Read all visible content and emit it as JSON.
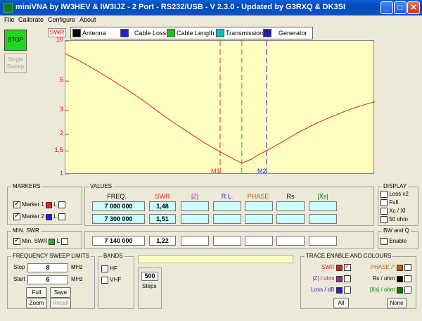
{
  "window": {
    "title": "miniVNA by IW3HEV & IW3IJZ - 2 Port - RS232/USB - V 2.3.0 - Updated by G3RXQ & DK3SI",
    "buttons": {
      "minimize": "_",
      "maximize": "□",
      "close": "✕"
    }
  },
  "menu": {
    "file": "File",
    "calibrate": "Calibrate",
    "configure": "Configure",
    "about": "About"
  },
  "left_controls": {
    "stop": "STOP",
    "single_sweep": "Single Sweep"
  },
  "trace_toolbar": {
    "swr_tag": "SWR",
    "tabs": [
      {
        "label": "Antenna",
        "icon": "antenna-icon",
        "color": "#000000"
      },
      {
        "label": "Cable Loss",
        "icon": "cable-loss-icon",
        "color": "#2020e0"
      },
      {
        "label": "Cable Length",
        "icon": "cable-length-icon",
        "color": "#20c020"
      },
      {
        "label": "Transmission",
        "icon": "transmission-icon",
        "color": "#00c0c0"
      },
      {
        "label": "Generator",
        "icon": "generator-icon",
        "color": "#2020a0"
      }
    ]
  },
  "chart_data": {
    "type": "line",
    "y_scale": "log",
    "ylim": [
      1,
      10
    ],
    "ylabel": "SWR",
    "yticks": [
      "10",
      "5",
      "3",
      "2",
      "1,5",
      "1"
    ],
    "xlim": [
      6.0,
      8.0
    ],
    "x_unit": "MHz",
    "grid": false,
    "background": "#ffffc0",
    "series": [
      {
        "color": "#e02020",
        "x": [
          6.0,
          6.1,
          6.2,
          6.3,
          6.4,
          6.5,
          6.6,
          6.7,
          6.8,
          6.9,
          7.0,
          7.05,
          7.1,
          7.14,
          7.2,
          7.25,
          7.3,
          7.4,
          7.5,
          7.6,
          7.7,
          7.8,
          7.9,
          8.0
        ],
        "y": [
          8.0,
          7.0,
          6.0,
          5.1,
          4.3,
          3.6,
          2.95,
          2.45,
          2.05,
          1.72,
          1.48,
          1.38,
          1.28,
          1.22,
          1.3,
          1.41,
          1.51,
          1.75,
          2.05,
          2.35,
          2.65,
          2.95,
          3.25,
          3.5
        ]
      }
    ],
    "markers": [
      {
        "label": "M1",
        "x": 7.0,
        "color": "#e02020"
      },
      {
        "label": "",
        "x": 7.14,
        "color": "#20b020"
      },
      {
        "label": "M2",
        "x": 7.3,
        "color": "#2020e0"
      }
    ]
  },
  "markers_panel": {
    "title": "MARKERS",
    "rows": [
      {
        "label": "Marker 1",
        "checked": true,
        "color": "#e02020",
        "l_label": "L",
        "l_checked": false
      },
      {
        "label": "Marker 2",
        "checked": true,
        "color": "#2020e0",
        "l_label": "L",
        "l_checked": false
      }
    ]
  },
  "values_panel": {
    "title": "VALUES",
    "headers": [
      {
        "label": "FREQ.",
        "color": "#000000"
      },
      {
        "label": "SWR",
        "color": "#e02020"
      },
      {
        "label": "|Z|",
        "color": "#a020a0"
      },
      {
        "label": "R.L.",
        "color": "#2020c0"
      },
      {
        "label": "PHASE",
        "color": "#c06000"
      },
      {
        "label": "Rs",
        "color": "#000000"
      },
      {
        "label": "|Xs|",
        "color": "#008000"
      }
    ],
    "rows": [
      {
        "freq": "7 000 000",
        "swr": "1,48"
      },
      {
        "freq": "7 300 000",
        "swr": "1,51"
      }
    ],
    "min_row": {
      "freq": "7 140 000",
      "swr": "1,22"
    }
  },
  "min_swr_panel": {
    "title": "MIN. SWR",
    "label": "Min. SWR",
    "checked": true,
    "color": "#20b020",
    "l_label": "L"
  },
  "display_panel": {
    "title": "DISPLAY",
    "options": [
      "Loss x2",
      "Full",
      "Xc / Xl",
      "50 ohm"
    ]
  },
  "bwq_panel": {
    "title": "BW and Q",
    "enable": "Enable"
  },
  "sweep_panel": {
    "title": "FREQUENCY SWEEP LIMITS",
    "stop_label": "Stop",
    "stop_value": "8",
    "start_label": "Start",
    "start_value": "6",
    "unit": "MHz",
    "buttons": {
      "full": "Full",
      "save": "Save",
      "zoom": "Zoom",
      "recall": "Recall"
    }
  },
  "bands_panel": {
    "title": "BANDS",
    "hf": "HF",
    "vhf": "VHF"
  },
  "steps": {
    "value": "500",
    "label": "Steps"
  },
  "trace_enable_panel": {
    "title": "TRACE ENABLE AND COLOURS",
    "left": [
      {
        "label": "SWR",
        "color": "#e02020",
        "checked": true
      },
      {
        "label": "|Z| / ohm",
        "color": "#a020a0",
        "checked": false
      },
      {
        "label": "Loss / dB",
        "color": "#2020c0",
        "checked": false
      }
    ],
    "right": [
      {
        "label": "PHASE /°",
        "color": "#c06000",
        "checked": false
      },
      {
        "label": "Rs / ohm",
        "color": "#000000",
        "checked": false
      },
      {
        "label": "|Xs| / ohm",
        "color": "#008000",
        "checked": false
      }
    ],
    "all": "All",
    "none": "None"
  }
}
